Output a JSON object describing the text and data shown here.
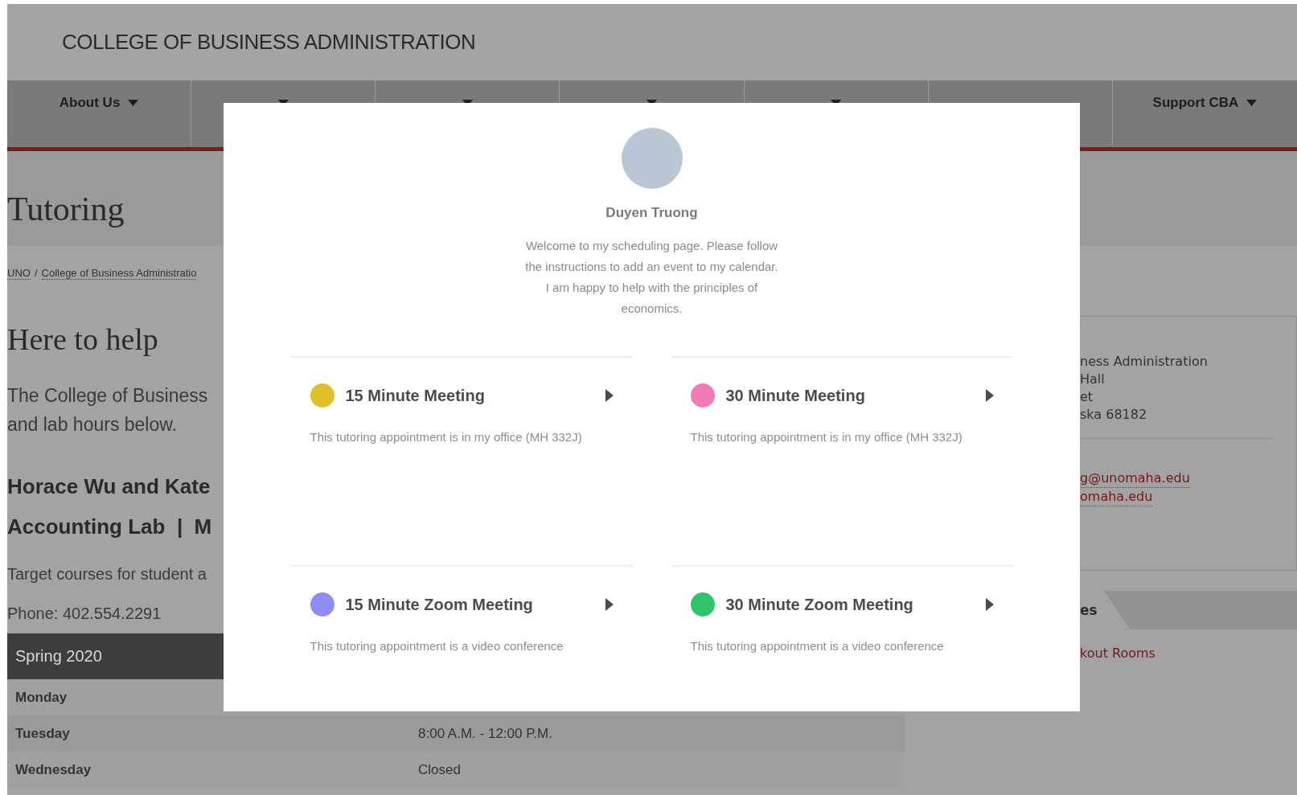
{
  "header": {
    "title": "COLLEGE OF BUSINESS ADMINISTRATION"
  },
  "nav": [
    {
      "label": "About Us",
      "has_menu": true
    },
    {
      "has_menu": true
    },
    {
      "has_menu": true
    },
    {
      "has_menu": true
    },
    {
      "has_menu": true
    },
    {
      "has_menu": false
    },
    {
      "label": "Support CBA",
      "has_menu": true
    }
  ],
  "page_title": "Tutoring",
  "breadcrumb": {
    "separator": "/",
    "items": [
      "UNO",
      "College of Business Administratio"
    ]
  },
  "heading": "Here to help",
  "intro": [
    "The College of Business",
    "and lab hours below."
  ],
  "subheadings": [
    "Horace Wu and Kate",
    "Accounting Lab  |  M"
  ],
  "lines": [
    "Target courses for student a",
    "Phone: 402.554.2291"
  ],
  "schedule": {
    "title": "Spring 2020",
    "rows": [
      {
        "day": "Monday"
      },
      {
        "day": "Tuesday",
        "hours": "8:00 A.M. - 12:00 P.M."
      },
      {
        "day": "Wednesday",
        "hours": "Closed"
      }
    ]
  },
  "sidebar": {
    "address": [
      "ness Administration",
      "Hall",
      "et",
      "ska 68182"
    ],
    "emails": [
      "g@unomaha.edu",
      "omaha.edu"
    ],
    "tab": "es",
    "link": "kout Rooms"
  },
  "modal": {
    "name": "Duyen Truong",
    "description": "Welcome to my scheduling page. Please follow the instructions to add an event to my calendar. I am happy to help with the principles of economics.",
    "events": [
      {
        "title": "15 Minute Meeting",
        "description": "This tutoring appointment is in my office (MH 332J)",
        "color": "#e0c12a"
      },
      {
        "title": "30 Minute Meeting",
        "description": "This tutoring appointment is in my office (MH 332J)",
        "color": "#f47ab5"
      },
      {
        "title": "15 Minute Zoom Meeting",
        "description": "This tutoring appointment is a video conference",
        "color": "#8f8cf5"
      },
      {
        "title": "30 Minute Zoom Meeting",
        "description": "This tutoring appointment is a video conference",
        "color": "#2fc46c"
      }
    ]
  }
}
